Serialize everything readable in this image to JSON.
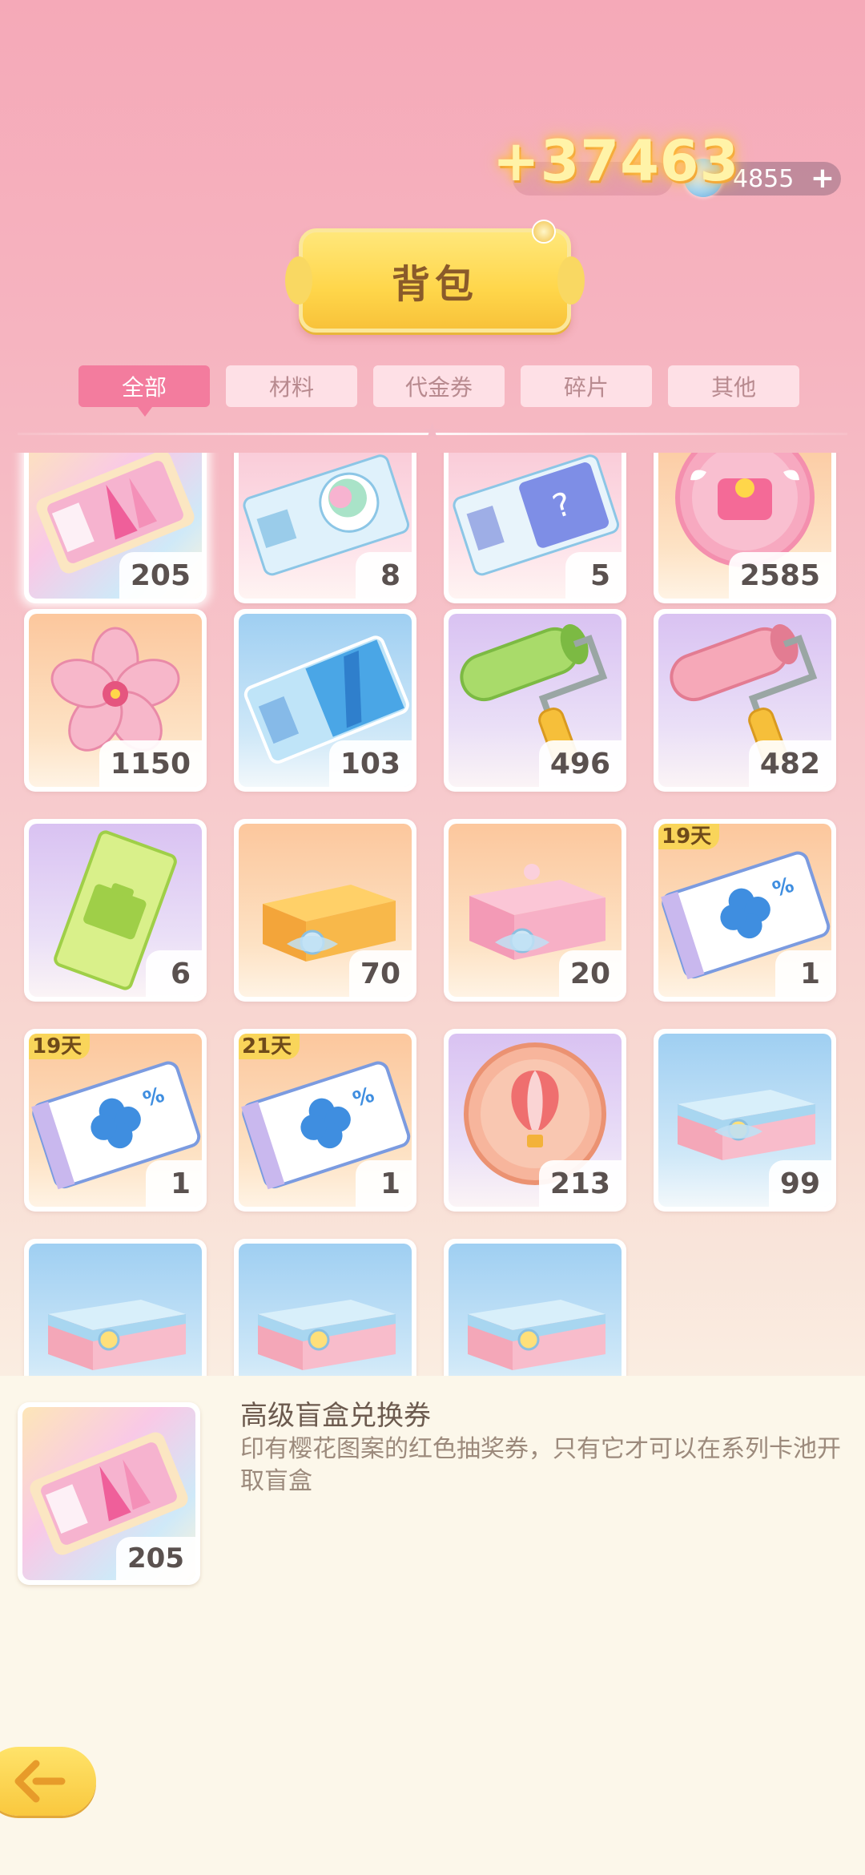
{
  "header": {
    "gain_amount": "+37463",
    "gem_balance": "4855",
    "gem_add_label": "+"
  },
  "title": "背包",
  "tabs": [
    {
      "label": "全部",
      "active": true
    },
    {
      "label": "材料",
      "active": false
    },
    {
      "label": "代金券",
      "active": false
    },
    {
      "label": "碎片",
      "active": false
    },
    {
      "label": "其他",
      "active": false
    }
  ],
  "items": [
    {
      "icon": "premium-blindbox-ticket-icon",
      "count": "205",
      "selected": true
    },
    {
      "icon": "avatar-ticket-icon",
      "count": "8"
    },
    {
      "icon": "mystery-ticket-icon",
      "count": "5"
    },
    {
      "icon": "pink-bag-coin-icon",
      "count": "2585"
    },
    {
      "icon": "sakura-flower-icon",
      "count": "1150"
    },
    {
      "icon": "blue-ticket-icon",
      "count": "103"
    },
    {
      "icon": "green-paint-roller-icon",
      "count": "496"
    },
    {
      "icon": "pink-paint-roller-icon",
      "count": "482"
    },
    {
      "icon": "green-coupon-icon",
      "count": "6"
    },
    {
      "icon": "orange-gift-box-icon",
      "count": "70"
    },
    {
      "icon": "pink-gift-box-icon",
      "count": "20"
    },
    {
      "icon": "sale-coupon-icon",
      "count": "1",
      "expiry": "19天"
    },
    {
      "icon": "sale-coupon-icon",
      "count": "1",
      "expiry": "19天"
    },
    {
      "icon": "sale-coupon-icon",
      "count": "1",
      "expiry": "21天"
    },
    {
      "icon": "hot-air-balloon-coin-icon",
      "count": "213"
    },
    {
      "icon": "blue-gift-box-icon",
      "count": "99"
    },
    {
      "icon": "blue-gift-box-icon",
      "count": ""
    },
    {
      "icon": "blue-gift-box-icon",
      "count": ""
    },
    {
      "icon": "blue-gift-box-icon",
      "count": ""
    }
  ],
  "detail": {
    "name": "高级盲盒兑换券",
    "description": "印有樱花图案的红色抽奖券，只有它才可以在系列卡池开取盲盒",
    "count": "205"
  },
  "colors": {
    "accent_pink": "#f37c9e",
    "banner_gold": "#ffd64a",
    "expiry_yellow": "#f9d55a",
    "panel_cream": "#fcf7ea"
  }
}
